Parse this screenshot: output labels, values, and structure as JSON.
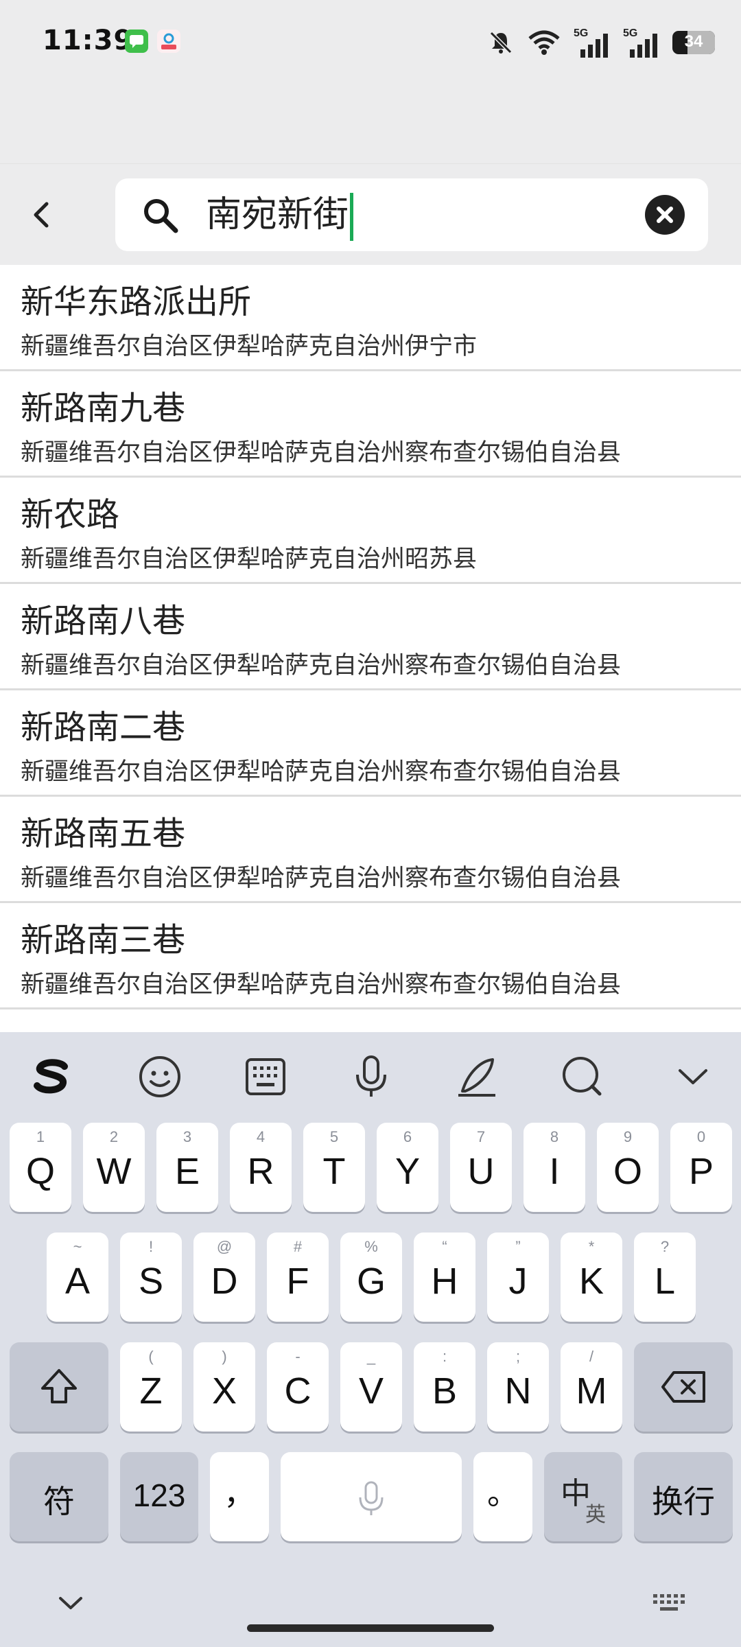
{
  "status_bar": {
    "time": "11:39",
    "battery": "34",
    "net1": "5G",
    "net2": "5G"
  },
  "search": {
    "query": "南宛新街",
    "back_icon": "chevron-left-icon",
    "clear_icon": "clear-icon"
  },
  "results": [
    {
      "title": "新华东路派出所",
      "subtitle": "新疆维吾尔自治区伊犁哈萨克自治州伊宁市"
    },
    {
      "title": "新路南九巷",
      "subtitle": "新疆维吾尔自治区伊犁哈萨克自治州察布查尔锡伯自治县"
    },
    {
      "title": "新农路",
      "subtitle": "新疆维吾尔自治区伊犁哈萨克自治州昭苏县"
    },
    {
      "title": "新路南八巷",
      "subtitle": "新疆维吾尔自治区伊犁哈萨克自治州察布查尔锡伯自治县"
    },
    {
      "title": "新路南二巷",
      "subtitle": "新疆维吾尔自治区伊犁哈萨克自治州察布查尔锡伯自治县"
    },
    {
      "title": "新路南五巷",
      "subtitle": "新疆维吾尔自治区伊犁哈萨克自治州察布查尔锡伯自治县"
    },
    {
      "title": "新路南三巷",
      "subtitle": "新疆维吾尔自治区伊犁哈萨克自治州察布查尔锡伯自治县"
    }
  ],
  "keyboard": {
    "toolbar": [
      "sogou-logo-icon",
      "emoji-icon",
      "keyboard-layout-icon",
      "microphone-icon",
      "handwriting-icon",
      "search-icon",
      "collapse-icon"
    ],
    "row1": [
      {
        "label": "Q",
        "hint": "1"
      },
      {
        "label": "W",
        "hint": "2"
      },
      {
        "label": "E",
        "hint": "3"
      },
      {
        "label": "R",
        "hint": "4"
      },
      {
        "label": "T",
        "hint": "5"
      },
      {
        "label": "Y",
        "hint": "6"
      },
      {
        "label": "U",
        "hint": "7"
      },
      {
        "label": "I",
        "hint": "8"
      },
      {
        "label": "O",
        "hint": "9"
      },
      {
        "label": "P",
        "hint": "0"
      }
    ],
    "row2": [
      {
        "label": "A",
        "hint": "~"
      },
      {
        "label": "S",
        "hint": "!"
      },
      {
        "label": "D",
        "hint": "@"
      },
      {
        "label": "F",
        "hint": "#"
      },
      {
        "label": "G",
        "hint": "%"
      },
      {
        "label": "H",
        "hint": "“"
      },
      {
        "label": "J",
        "hint": "”"
      },
      {
        "label": "K",
        "hint": "*"
      },
      {
        "label": "L",
        "hint": "?"
      }
    ],
    "row3": [
      {
        "label": "Z",
        "hint": "("
      },
      {
        "label": "X",
        "hint": ")"
      },
      {
        "label": "C",
        "hint": "-"
      },
      {
        "label": "V",
        "hint": "_"
      },
      {
        "label": "B",
        "hint": ":"
      },
      {
        "label": "N",
        "hint": ";"
      },
      {
        "label": "M",
        "hint": "/"
      }
    ],
    "symbols": "符",
    "numbers": "123",
    "comma": "，",
    "period": "。",
    "lang_main": "中",
    "lang_sub": "英",
    "enter": "换行"
  }
}
